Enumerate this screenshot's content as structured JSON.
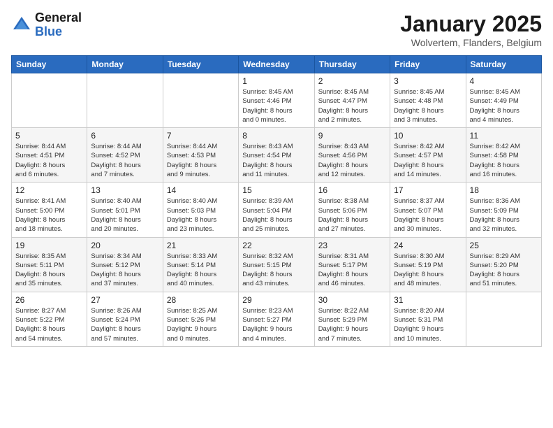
{
  "header": {
    "logo_general": "General",
    "logo_blue": "Blue",
    "title": "January 2025",
    "location": "Wolvertem, Flanders, Belgium"
  },
  "weekdays": [
    "Sunday",
    "Monday",
    "Tuesday",
    "Wednesday",
    "Thursday",
    "Friday",
    "Saturday"
  ],
  "weeks": [
    [
      {
        "day": "",
        "info": ""
      },
      {
        "day": "",
        "info": ""
      },
      {
        "day": "",
        "info": ""
      },
      {
        "day": "1",
        "info": "Sunrise: 8:45 AM\nSunset: 4:46 PM\nDaylight: 8 hours\nand 0 minutes."
      },
      {
        "day": "2",
        "info": "Sunrise: 8:45 AM\nSunset: 4:47 PM\nDaylight: 8 hours\nand 2 minutes."
      },
      {
        "day": "3",
        "info": "Sunrise: 8:45 AM\nSunset: 4:48 PM\nDaylight: 8 hours\nand 3 minutes."
      },
      {
        "day": "4",
        "info": "Sunrise: 8:45 AM\nSunset: 4:49 PM\nDaylight: 8 hours\nand 4 minutes."
      }
    ],
    [
      {
        "day": "5",
        "info": "Sunrise: 8:44 AM\nSunset: 4:51 PM\nDaylight: 8 hours\nand 6 minutes."
      },
      {
        "day": "6",
        "info": "Sunrise: 8:44 AM\nSunset: 4:52 PM\nDaylight: 8 hours\nand 7 minutes."
      },
      {
        "day": "7",
        "info": "Sunrise: 8:44 AM\nSunset: 4:53 PM\nDaylight: 8 hours\nand 9 minutes."
      },
      {
        "day": "8",
        "info": "Sunrise: 8:43 AM\nSunset: 4:54 PM\nDaylight: 8 hours\nand 11 minutes."
      },
      {
        "day": "9",
        "info": "Sunrise: 8:43 AM\nSunset: 4:56 PM\nDaylight: 8 hours\nand 12 minutes."
      },
      {
        "day": "10",
        "info": "Sunrise: 8:42 AM\nSunset: 4:57 PM\nDaylight: 8 hours\nand 14 minutes."
      },
      {
        "day": "11",
        "info": "Sunrise: 8:42 AM\nSunset: 4:58 PM\nDaylight: 8 hours\nand 16 minutes."
      }
    ],
    [
      {
        "day": "12",
        "info": "Sunrise: 8:41 AM\nSunset: 5:00 PM\nDaylight: 8 hours\nand 18 minutes."
      },
      {
        "day": "13",
        "info": "Sunrise: 8:40 AM\nSunset: 5:01 PM\nDaylight: 8 hours\nand 20 minutes."
      },
      {
        "day": "14",
        "info": "Sunrise: 8:40 AM\nSunset: 5:03 PM\nDaylight: 8 hours\nand 23 minutes."
      },
      {
        "day": "15",
        "info": "Sunrise: 8:39 AM\nSunset: 5:04 PM\nDaylight: 8 hours\nand 25 minutes."
      },
      {
        "day": "16",
        "info": "Sunrise: 8:38 AM\nSunset: 5:06 PM\nDaylight: 8 hours\nand 27 minutes."
      },
      {
        "day": "17",
        "info": "Sunrise: 8:37 AM\nSunset: 5:07 PM\nDaylight: 8 hours\nand 30 minutes."
      },
      {
        "day": "18",
        "info": "Sunrise: 8:36 AM\nSunset: 5:09 PM\nDaylight: 8 hours\nand 32 minutes."
      }
    ],
    [
      {
        "day": "19",
        "info": "Sunrise: 8:35 AM\nSunset: 5:11 PM\nDaylight: 8 hours\nand 35 minutes."
      },
      {
        "day": "20",
        "info": "Sunrise: 8:34 AM\nSunset: 5:12 PM\nDaylight: 8 hours\nand 37 minutes."
      },
      {
        "day": "21",
        "info": "Sunrise: 8:33 AM\nSunset: 5:14 PM\nDaylight: 8 hours\nand 40 minutes."
      },
      {
        "day": "22",
        "info": "Sunrise: 8:32 AM\nSunset: 5:15 PM\nDaylight: 8 hours\nand 43 minutes."
      },
      {
        "day": "23",
        "info": "Sunrise: 8:31 AM\nSunset: 5:17 PM\nDaylight: 8 hours\nand 46 minutes."
      },
      {
        "day": "24",
        "info": "Sunrise: 8:30 AM\nSunset: 5:19 PM\nDaylight: 8 hours\nand 48 minutes."
      },
      {
        "day": "25",
        "info": "Sunrise: 8:29 AM\nSunset: 5:20 PM\nDaylight: 8 hours\nand 51 minutes."
      }
    ],
    [
      {
        "day": "26",
        "info": "Sunrise: 8:27 AM\nSunset: 5:22 PM\nDaylight: 8 hours\nand 54 minutes."
      },
      {
        "day": "27",
        "info": "Sunrise: 8:26 AM\nSunset: 5:24 PM\nDaylight: 8 hours\nand 57 minutes."
      },
      {
        "day": "28",
        "info": "Sunrise: 8:25 AM\nSunset: 5:26 PM\nDaylight: 9 hours\nand 0 minutes."
      },
      {
        "day": "29",
        "info": "Sunrise: 8:23 AM\nSunset: 5:27 PM\nDaylight: 9 hours\nand 4 minutes."
      },
      {
        "day": "30",
        "info": "Sunrise: 8:22 AM\nSunset: 5:29 PM\nDaylight: 9 hours\nand 7 minutes."
      },
      {
        "day": "31",
        "info": "Sunrise: 8:20 AM\nSunset: 5:31 PM\nDaylight: 9 hours\nand 10 minutes."
      },
      {
        "day": "",
        "info": ""
      }
    ]
  ]
}
